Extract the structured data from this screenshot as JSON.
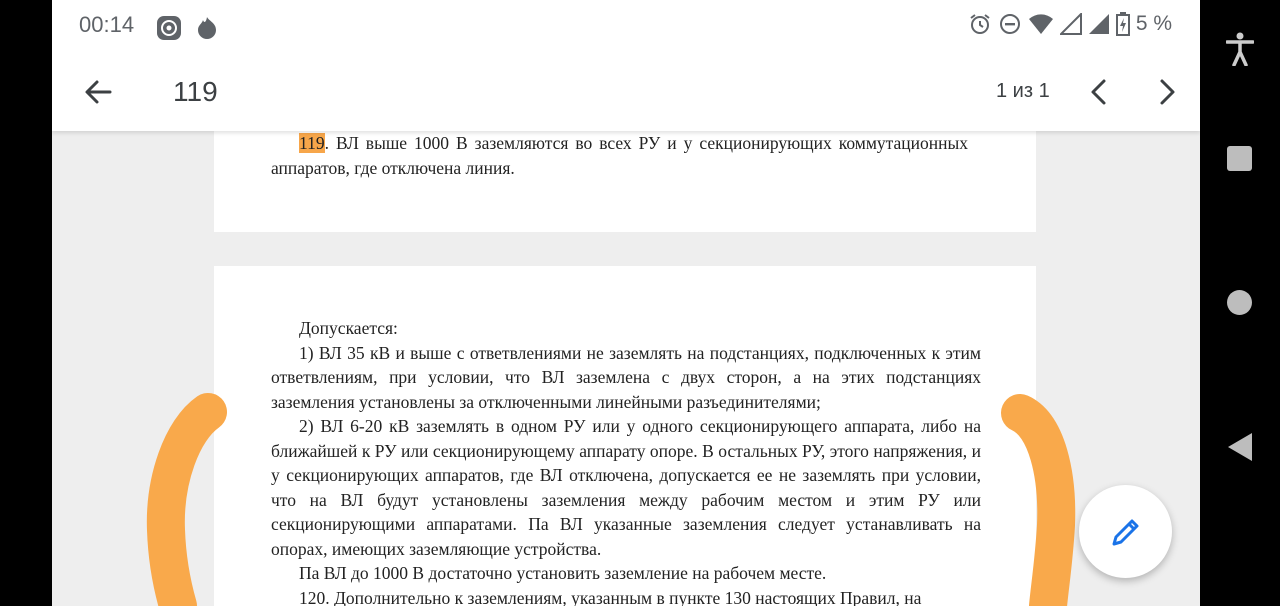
{
  "status_bar": {
    "time": "00:14",
    "battery": "5 %",
    "icons": [
      "vpn-icon",
      "notification-icon",
      "alarm-icon",
      "do-not-disturb-icon",
      "wifi-icon",
      "signal-icon",
      "signal-icon-2",
      "battery-icon"
    ]
  },
  "toolbar": {
    "title": "119",
    "counter": "1 из 1",
    "back_icon": "arrow-back-icon",
    "prev_icon": "chevron-left-icon",
    "next_icon": "chevron-right-icon"
  },
  "page1": {
    "highlight": "119",
    "rest": ". ВЛ выше 1000 В заземляются во всех РУ и у секционирующих коммутационных аппаратов, где отключена линия."
  },
  "page2": {
    "lines": [
      "Допускается:",
      "1) ВЛ 35 кВ и выше с ответвлениями не заземлять на подстанциях, подключенных к этим ответвлениям, при условии, что ВЛ заземлена с двух сторон, а на этих подстанциях заземления установлены за отключенными линейными разъединителями;",
      "2) ВЛ 6-20 кВ заземлять в одном РУ или у одного секционирующего аппарата, либо на ближайшей к РУ или секционирующему аппарату опоре. В остальных РУ, этого напряжения, и у секционирующих аппаратов, где ВЛ отключена, допускается ее не заземлять при условии, что на ВЛ будут установлены заземления между рабочим местом и этим РУ или секционирующими аппаратами. Па ВЛ указанные заземления следует устанавливать на опорах, имеющих заземляющие устройства.",
      "Па ВЛ до 1000 В достаточно установить заземление на рабочем месте.",
      "120. Дополнительно к заземлениям, указанным в пункте 130 настоящих Правил, на"
    ]
  },
  "fab": {
    "icon": "pencil-edit-icon"
  },
  "nav": {
    "icons": [
      "accessibility-icon",
      "recents-square-icon",
      "home-circle-icon",
      "back-triangle-icon"
    ]
  },
  "colors": {
    "highlight": "#f7a64a",
    "annotation": "#f9a94b",
    "accent_blue": "#1a73e8"
  }
}
